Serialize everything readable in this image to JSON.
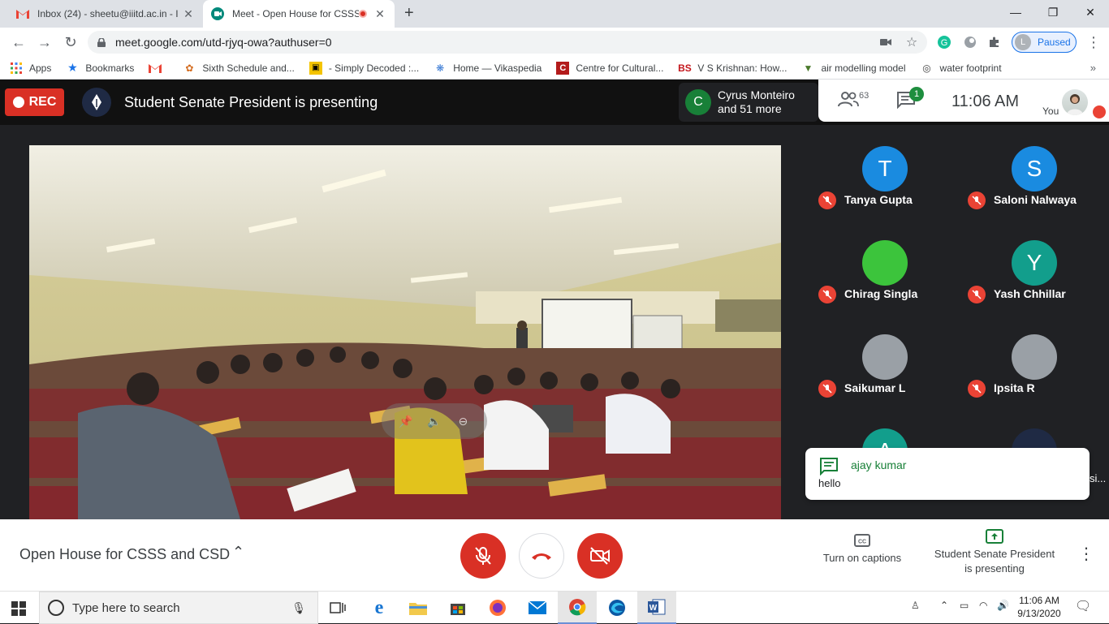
{
  "browser": {
    "tabs": [
      {
        "title": "Inbox (24) - sheetu@iiitd.ac.in - I",
        "icon": "gmail-icon"
      },
      {
        "title": "Meet - Open House for CSSS",
        "icon": "meet-icon",
        "recording": true
      }
    ],
    "url": "meet.google.com/utd-rjyq-owa?authuser=0",
    "profile_initial": "L",
    "profile_status": "Paused"
  },
  "bookmarks": [
    {
      "label": "Apps",
      "icon": "apps-grid-icon"
    },
    {
      "label": "Bookmarks",
      "icon": "star-icon"
    },
    {
      "label": "",
      "icon": "gmail-icon"
    },
    {
      "label": "Sixth Schedule and...",
      "icon": "bookmark-favicon"
    },
    {
      "label": "- Simply Decoded :...",
      "icon": "bookmark-favicon"
    },
    {
      "label": "Home — Vikaspedia",
      "icon": "bookmark-favicon"
    },
    {
      "label": "Centre for Cultural...",
      "icon": "bookmark-favicon"
    },
    {
      "label": "V S Krishnan: How...",
      "icon": "bs-favicon"
    },
    {
      "label": "air modelling model",
      "icon": "bookmark-favicon"
    },
    {
      "label": "water footprint",
      "icon": "globe-icon"
    }
  ],
  "meet": {
    "rec_label": "REC",
    "presenting_text": "Student Senate President is presenting",
    "cyrus": {
      "initial": "C",
      "line1": "Cyrus Monteiro",
      "line2": "and 51 more"
    },
    "participants_count": "63",
    "chat_badge": "1",
    "time": "11:06  AM",
    "you_label": "You",
    "participants": [
      {
        "name": "Tanya Gupta",
        "initial": "T",
        "color": "#1a8be0"
      },
      {
        "name": "Saloni Nalwaya",
        "initial": "S",
        "color": "#1a8be0"
      },
      {
        "name": "Chirag Singla",
        "initial": "",
        "color": "#3cc43c"
      },
      {
        "name": "Yash Chhillar",
        "initial": "Y",
        "color": "#129e8c"
      },
      {
        "name": "Saikumar L",
        "initial": "",
        "color": "#9aa0a6"
      },
      {
        "name": "Ipsita R",
        "initial": "",
        "color": "#9aa0a6"
      },
      {
        "name": "",
        "initial": "A",
        "color": "#129e8c"
      },
      {
        "name": "",
        "initial": "",
        "color": "#1f2a44"
      }
    ],
    "chat_toast": {
      "sender": "ajay kumar",
      "message": "hello",
      "trailing": "si..."
    },
    "meeting_title": "Open House for CSSS and CSD",
    "captions_label": "Turn on captions",
    "present_label_1": "Student Senate President",
    "present_label_2": "is presenting"
  },
  "taskbar": {
    "search_placeholder": "Type here to search",
    "clock_time": "11:06 AM",
    "clock_date": "9/13/2020"
  },
  "colors": {
    "accent_red": "#d93025",
    "meet_green": "#188038",
    "chrome_blue": "#1a73e8"
  }
}
